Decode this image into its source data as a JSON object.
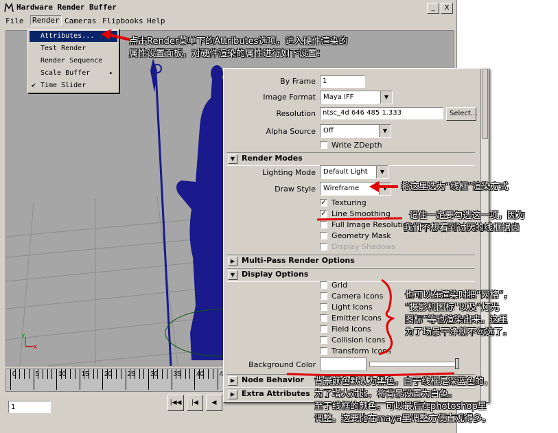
{
  "window": {
    "title": "Hardware Render Buffer",
    "buttons": [
      "_",
      "X"
    ]
  },
  "menubar": [
    "File",
    "Render",
    "Cameras",
    "Flipbooks",
    "Help"
  ],
  "render_menu": {
    "items": [
      {
        "label": "Attributes...",
        "highlighted": true
      },
      {
        "label": "Test Render"
      },
      {
        "label": "Render Sequence"
      },
      {
        "label": "Scale Buffer",
        "submenu": true
      },
      {
        "label": "Time Slider",
        "checked": true
      }
    ]
  },
  "timeline": {
    "ticks": [
      "0",
      "5",
      "10",
      "15",
      "20",
      "25",
      "30",
      "35",
      "40",
      "45"
    ],
    "current_frame": "1"
  },
  "attributes": {
    "by_frame": {
      "label": "By Frame",
      "value": "1"
    },
    "image_format": {
      "label": "Image Format",
      "value": "Maya IFF"
    },
    "resolution": {
      "label": "Resolution",
      "value": "ntsc_4d 646 485 1.333",
      "button": "Select..."
    },
    "alpha_source": {
      "label": "Alpha Source",
      "value": "Off"
    },
    "write_zdepth": "Write ZDepth",
    "render_modes": {
      "header": "Render Modes",
      "lighting_mode": {
        "label": "Lighting Mode",
        "value": "Default Light"
      },
      "draw_style": {
        "label": "Draw Style",
        "value": "Wireframe"
      },
      "checks": [
        {
          "label": "Texturing",
          "checked": true,
          "disabled": false
        },
        {
          "label": "Line Smoothing",
          "checked": true,
          "disabled": false
        },
        {
          "label": "Full Image Resolution",
          "checked": false,
          "disabled": false
        },
        {
          "label": "Geometry Mask",
          "checked": false,
          "disabled": false
        },
        {
          "label": "Display Shadows",
          "checked": false,
          "disabled": true
        }
      ]
    },
    "multipass_header": "Multi-Pass Render Options",
    "display_options": {
      "header": "Display Options",
      "checks": [
        "Grid",
        "Camera Icons",
        "Light Icons",
        "Emitter Icons",
        "Field Icons",
        "Collision Icons",
        "Transform Icons"
      ],
      "background_color_label": "Background Color"
    },
    "node_behavior_header": "Node Behavior",
    "extra_attributes_header": "Extra Attributes"
  },
  "annotations": {
    "top": [
      "点击Render菜单下的Attributes选项，进入硬件渲染的",
      "属性设置面板，对硬件渲染的属性进行如下设置："
    ],
    "draw_style": "将这里选为“线框”渲染方式",
    "line_smoothing": [
      "记住一定要勾选这一项，因为",
      "我们不想看到讨厌的线框锯齿"
    ],
    "display_options": [
      "也可以在渲染时把“网格”，",
      "“摄影机图标”以及“灯光",
      "图标”等也渲染出来。这里",
      "为了场景干净就不勾选了。"
    ],
    "background": [
      "背景颜色默认为黑色，由于线框是深蓝色的，",
      "为了增大对比，将背景设置为白色。",
      "至于线框的颜色，可以最后在photoshop里",
      "调整。这要比在maya里调整方便直观得多。"
    ]
  },
  "colors": {
    "annotation_red": "#e00000",
    "statue_blue": "#1a1a8c",
    "viewport_gray": "#a6a6a6"
  }
}
